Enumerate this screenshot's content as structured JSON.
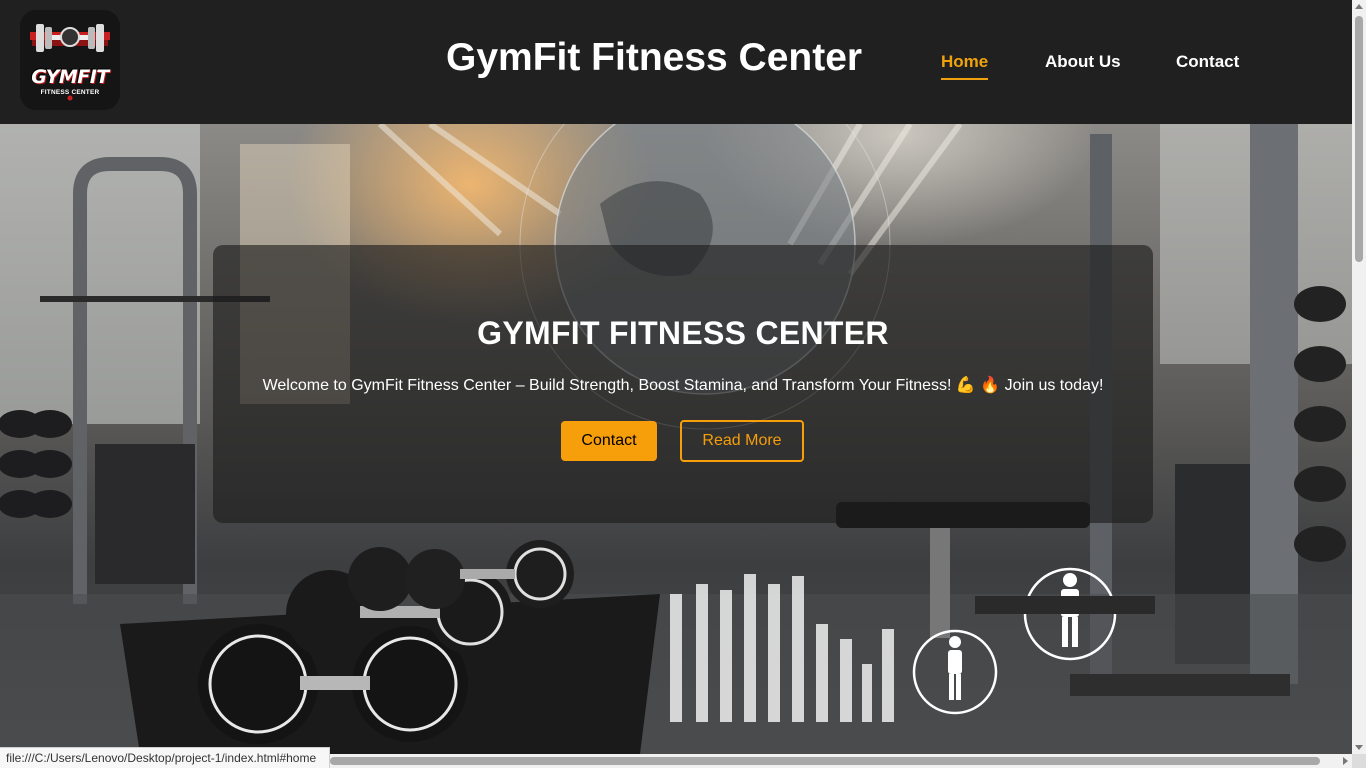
{
  "header": {
    "logo": {
      "word": "GYMFIT",
      "sub": "FITNESS CENTER"
    },
    "title": "GymFit Fitness Center",
    "nav": [
      {
        "label": "Home",
        "active": true
      },
      {
        "label": "About Us",
        "active": false
      },
      {
        "label": "Contact",
        "active": false
      }
    ]
  },
  "hero": {
    "title": "GYMFIT FITNESS CENTER",
    "text": "Welcome to GymFit Fitness Center – Build Strength, Boost Stamina, and Transform Your Fitness! 💪 🔥 Join us today!",
    "buttons": {
      "contact": "Contact",
      "read_more": "Read More"
    }
  },
  "status_bar": {
    "url": "file:///C:/Users/Lenovo/Desktop/project-1/index.html#home"
  },
  "colors": {
    "accent": "#f79e0b",
    "header_bg": "#202020",
    "nav_active": "#f0a20e"
  }
}
